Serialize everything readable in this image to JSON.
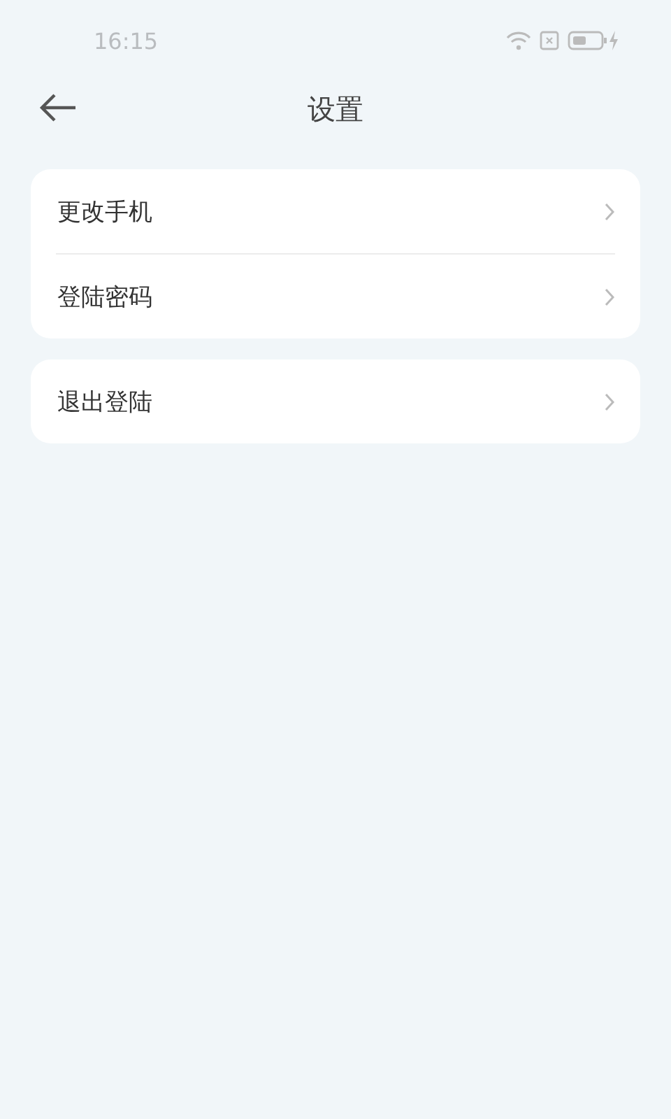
{
  "status_bar": {
    "time": "16:15"
  },
  "header": {
    "title": "设置"
  },
  "groups": [
    {
      "items": [
        {
          "label": "更改手机"
        },
        {
          "label": "登陆密码"
        }
      ]
    },
    {
      "items": [
        {
          "label": "退出登陆"
        }
      ]
    }
  ]
}
